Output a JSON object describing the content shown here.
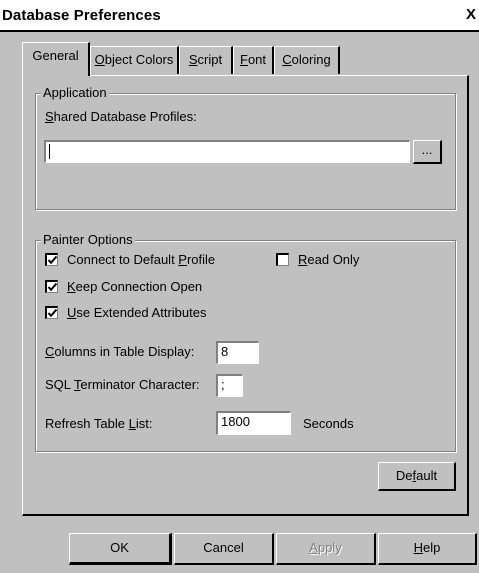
{
  "window": {
    "title": "Database Preferences",
    "close_glyph": "X"
  },
  "tabs": [
    {
      "label": "General",
      "active": true
    },
    {
      "label": "Object Colors",
      "mnemonic": "O"
    },
    {
      "label": "Script",
      "mnemonic": "S"
    },
    {
      "label": "Font",
      "mnemonic": "F"
    },
    {
      "label": "Coloring",
      "mnemonic": "C"
    }
  ],
  "application": {
    "group_label": "Application",
    "profiles_label": "Shared Database Profiles:",
    "profiles_mnemonic": "S",
    "profiles_value": "",
    "browse_label": "..."
  },
  "painter": {
    "group_label": "Painter Options",
    "connect_default": {
      "label": "Connect to Default Profile",
      "checked": true
    },
    "read_only": {
      "label": "Read Only",
      "checked": false
    },
    "keep_connection": {
      "label": "Keep Connection Open",
      "checked": true
    },
    "extended_attrs": {
      "label": "Use Extended Attributes",
      "checked": true
    },
    "columns_label": "Columns in Table Display:",
    "columns_value": "8",
    "terminator_label": "SQL Terminator Character:",
    "terminator_value": ";",
    "refresh_label": "Refresh Table List:",
    "refresh_value": "1800",
    "refresh_unit": "Seconds",
    "default_button": "Default"
  },
  "buttons": {
    "ok": "OK",
    "cancel": "Cancel",
    "apply": "Apply",
    "help": "Help"
  },
  "colors": {
    "face": "#c0c0c0",
    "shadow": "#808080",
    "highlight": "#ffffff",
    "text": "#000000"
  }
}
